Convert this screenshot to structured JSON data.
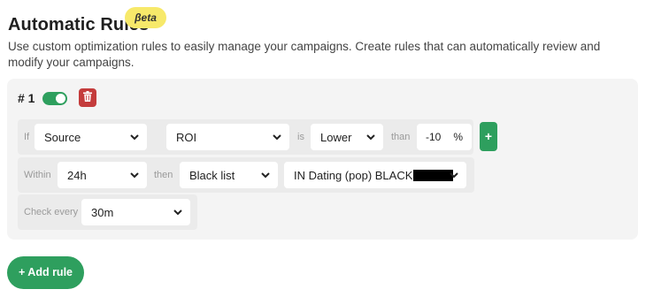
{
  "header": {
    "title": "Automatic Rules",
    "badge": "βeta",
    "description": "Use custom optimization rules to easily manage your campaigns. Create rules that can automatically review and modify your campaigns."
  },
  "rule": {
    "number": "# 1",
    "enabled": true,
    "condition": {
      "if_label": "If",
      "metric_source": "Source",
      "metric": "ROI",
      "is_label": "is",
      "comparator": "Lower",
      "than_label": "than",
      "value": "-10",
      "unit": "%",
      "add_condition_label": "+"
    },
    "action": {
      "within_label": "Within",
      "window": "24h",
      "then_label": "then",
      "action": "Black list",
      "target_list": "IN Dating (pop) BLACK"
    },
    "schedule": {
      "check_label": "Check every",
      "interval": "30m"
    }
  },
  "footer": {
    "add_rule_label": "+ Add rule"
  },
  "colors": {
    "accent_green": "#2e9f5e",
    "delete_red": "#c43c3c",
    "beta_yellow": "#f7e96a"
  }
}
